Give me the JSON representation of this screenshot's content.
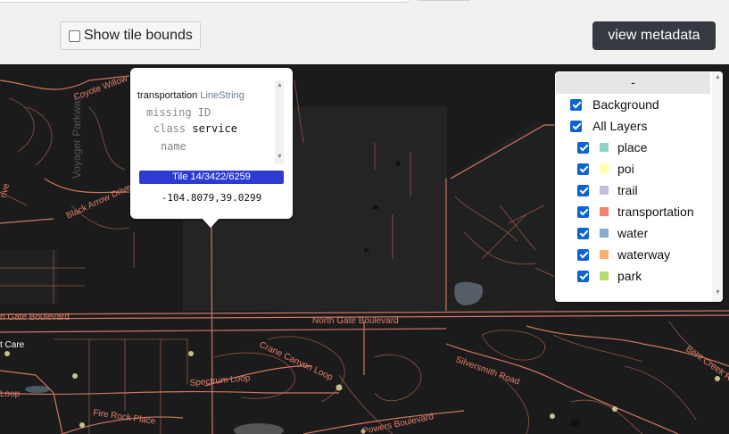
{
  "toolbar": {
    "show_tile_bounds_label": "Show tile bounds",
    "show_tile_bounds_checked": false,
    "view_metadata_label": "view metadata"
  },
  "map": {
    "street_labels": [
      "Coyote Willow",
      "Voyager Parkway",
      "Black Arrow Drive",
      "rive",
      "n Gate Boulevard",
      "North Gate Boulevard",
      "t Care",
      "Crane Canyon Loop",
      "Silversmith Road",
      "Spectrum Loop",
      "Loop",
      "Fire Rock Place",
      "Powers Boulevard",
      "Bent Creek Roa"
    ]
  },
  "popup": {
    "feature_layer": "transportation",
    "feature_geometry": "LineString",
    "missing_id_label": "missing ID",
    "properties": [
      {
        "key": "class",
        "value": "service"
      },
      {
        "key": "name",
        "value": ""
      }
    ],
    "tile_label": "Tile 14/3422/6259",
    "coordinates": "-104.8079,39.0299"
  },
  "layers": {
    "collapse_label": "-",
    "background_label": "Background",
    "all_layers_label": "All Layers",
    "items": [
      {
        "label": "place",
        "color": "#8fd3c4",
        "checked": true
      },
      {
        "label": "poi",
        "color": "#ffffa8",
        "checked": true
      },
      {
        "label": "trail",
        "color": "#c6bde1",
        "checked": true
      },
      {
        "label": "transportation",
        "color": "#f47f73",
        "checked": true
      },
      {
        "label": "water",
        "color": "#82acd0",
        "checked": true
      },
      {
        "label": "waterway",
        "color": "#fbb16a",
        "checked": true
      },
      {
        "label": "park",
        "color": "#b5de6e",
        "checked": true
      }
    ]
  },
  "colors": {
    "map_background": "#1b1b1b",
    "road": "#e2816c",
    "metadata_button": "#343a40",
    "tile_badge": "#2e3bd0",
    "checkbox_checked": "#0a64d2"
  }
}
